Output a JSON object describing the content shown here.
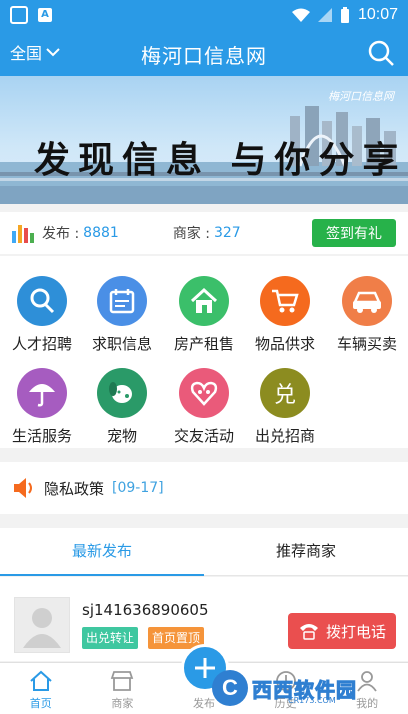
{
  "status_bar": {
    "time": "10:07",
    "app_badge": "A"
  },
  "header": {
    "region": "全国",
    "title": "梅河口信息网"
  },
  "banner": {
    "slogan": "发现信息 与你分享",
    "logo_text": "梅河口信息网"
  },
  "stats": {
    "publish_label": "发布 :",
    "publish_count": "8881",
    "merchant_label": "商家 :",
    "merchant_count": "327",
    "checkin_label": "签到有礼"
  },
  "categories": [
    {
      "label": "人才招聘",
      "icon": "magnifier-icon",
      "color": "#2e8fd8"
    },
    {
      "label": "求职信息",
      "icon": "calendar-icon",
      "color": "#4a8fe6"
    },
    {
      "label": "房产租售",
      "icon": "house-icon",
      "color": "#3bbf6a"
    },
    {
      "label": "物品供求",
      "icon": "cart-icon",
      "color": "#f56a1e"
    },
    {
      "label": "车辆买卖",
      "icon": "car-icon",
      "color": "#f07e48"
    },
    {
      "label": "生活服务",
      "icon": "umbrella-icon",
      "color": "#a65cc0"
    },
    {
      "label": "宠物",
      "icon": "dog-icon",
      "color": "#2a9a68"
    },
    {
      "label": "交友活动",
      "icon": "heart-icon",
      "color": "#ea5a7a"
    },
    {
      "label": "出兑招商",
      "icon": "dui-glyph-icon",
      "color": "#8c8c20",
      "glyph": "兑"
    }
  ],
  "notice": {
    "text": "隐私政策",
    "date": "[09-17]"
  },
  "tabs": [
    {
      "label": "最新发布",
      "active": true
    },
    {
      "label": "推荐商家",
      "active": false
    }
  ],
  "listing": {
    "title": "sj141636890605",
    "tags": [
      {
        "label": "出兑转让",
        "color": "#3fc7a0"
      },
      {
        "label": "首页置顶",
        "color": "#f5943a"
      }
    ],
    "call_label": "拨打电话"
  },
  "bottom_nav": [
    {
      "label": "首页",
      "icon": "home-icon",
      "active": true
    },
    {
      "label": "商家",
      "icon": "shop-icon",
      "active": false
    },
    {
      "label": "发布",
      "icon": "plus-icon",
      "active": false
    },
    {
      "label": "历史",
      "icon": "history-icon",
      "active": false
    },
    {
      "label": "我的",
      "icon": "user-icon",
      "active": false
    }
  ],
  "watermark": {
    "mark": "C",
    "text": "西西软件园",
    "url": "CR173.COM"
  },
  "colors": {
    "primary": "#2a9ae6",
    "green": "#27b24a",
    "red": "#ea4f4f"
  }
}
